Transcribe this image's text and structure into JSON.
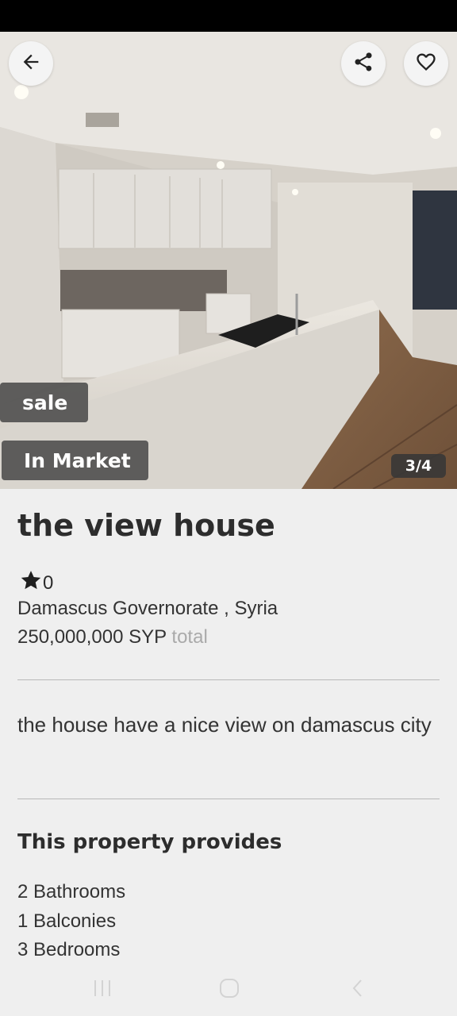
{
  "listing": {
    "title": "the view house",
    "rating": "0",
    "location": "Damascus Governorate , Syria",
    "price": "250,000,000 SYP",
    "price_unit": "total",
    "description": "the house have a nice view on damascus city"
  },
  "gallery": {
    "tag_type": "sale",
    "tag_status": "In Market",
    "counter": "3/4"
  },
  "icons": {
    "back": "arrow-left-icon",
    "share": "share-icon",
    "favorite": "heart-icon",
    "star": "star-icon"
  },
  "features": {
    "heading": "This property provides",
    "items": [
      "2 Bathrooms",
      "1 Balconies",
      "3 Bedrooms"
    ]
  }
}
